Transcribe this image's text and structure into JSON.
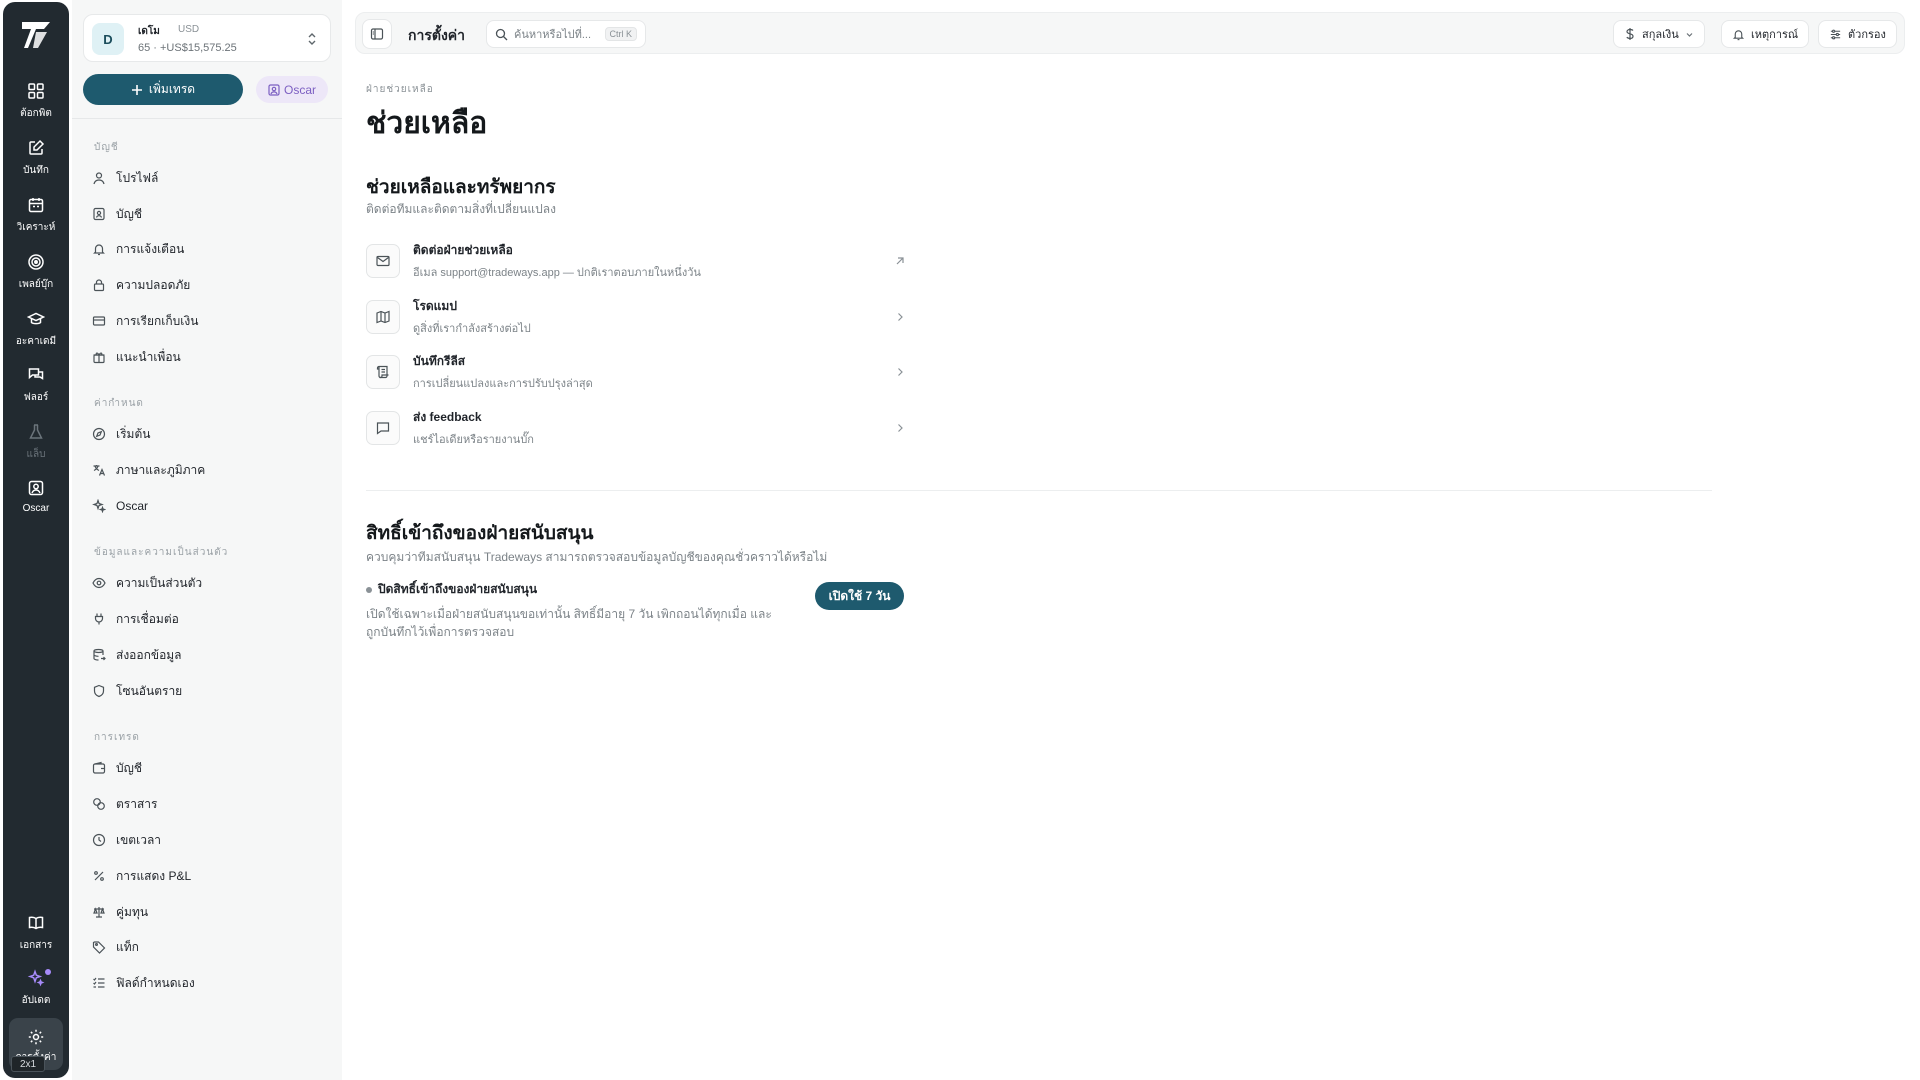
{
  "rail": {
    "items": [
      {
        "label": "ต้อกพิต",
        "icon": "dashboard-grid-icon"
      },
      {
        "label": "บันทึก",
        "icon": "journal-edit-icon"
      },
      {
        "label": "วิเคราะห์",
        "icon": "calendar-icon"
      },
      {
        "label": "เพลย์บุ๊ก",
        "icon": "target-icon"
      },
      {
        "label": "อะคาเดมี",
        "icon": "graduation-cap-icon"
      },
      {
        "label": "ฟลอร์",
        "icon": "chat-bubbles-icon"
      },
      {
        "label": "แล็บ",
        "icon": "flask-icon"
      },
      {
        "label": "Oscar",
        "icon": "oscar-portrait-icon"
      }
    ],
    "bottom": [
      {
        "label": "เอกสาร",
        "icon": "book-icon"
      },
      {
        "label": "อัปเดต",
        "icon": "sparkle-icon"
      },
      {
        "label": "การตั้งค่า",
        "icon": "gear-icon"
      }
    ],
    "badge": "2x1"
  },
  "account": {
    "avatar": "D",
    "name": "เดโม",
    "currency": "USD",
    "balance": "65 · +US$15,575.25"
  },
  "panel": {
    "add_trade": "เพิ่มเทรด",
    "oscar_chip": "Oscar",
    "sections": [
      {
        "label": "บัญชี",
        "items": [
          "โปรไฟล์",
          "บัญชี",
          "การแจ้งเตือน",
          "ความปลอดภัย",
          "การเรียกเก็บเงิน",
          "แนะนำเพื่อน"
        ]
      },
      {
        "label": "ค่ากำหนด",
        "items": [
          "เริ่มต้น",
          "ภาษาและภูมิภาค",
          "Oscar"
        ]
      },
      {
        "label": "ข้อมูลและความเป็นส่วนตัว",
        "items": [
          "ความเป็นส่วนตัว",
          "การเชื่อมต่อ",
          "ส่งออกข้อมูล",
          "โซนอันตราย"
        ]
      },
      {
        "label": "การเทรด",
        "items": [
          "บัญชี",
          "ตราสาร",
          "เขตเวลา",
          "การแสดง P&L",
          "คู่มทุน",
          "แท็ก",
          "ฟิลด์กำหนดเอง"
        ]
      }
    ]
  },
  "topbar": {
    "title": "การตั้งค่า",
    "search_placeholder": "ค้นหาหรือไปที่...",
    "search_shortcut": "Ctrl K",
    "currency": "สกุลเงิน",
    "events": "เหตุการณ์",
    "filters": "ตัวกรอง"
  },
  "main": {
    "breadcrumb": "ฝ่ายช่วยเหลือ",
    "title": "ช่วยเหลือ",
    "resources": {
      "title": "ช่วยเหลือและทรัพยากร",
      "subtitle": "ติดต่อทีมและติดตามสิ่งที่เปลี่ยนแปลง",
      "items": [
        {
          "title": "ติดต่อฝ่ายช่วยเหลือ",
          "desc": "อีเมล support@tradeways.app — ปกติเราตอบภายในหนึ่งวัน",
          "icon": "mail-icon",
          "arrow": "external-arrow-icon"
        },
        {
          "title": "โรดแมป",
          "desc": "ดูสิ่งที่เรากำลังสร้างต่อไป",
          "icon": "map-icon",
          "arrow": "chevron-right-icon"
        },
        {
          "title": "บันทึกรีลีส",
          "desc": "การเปลี่ยนแปลงและการปรับปรุงล่าสุด",
          "icon": "scroll-icon",
          "arrow": "chevron-right-icon"
        },
        {
          "title": "ส่ง feedback",
          "desc": "แชร์ไอเดียหรือรายงานบั๊ก",
          "icon": "message-square-icon",
          "arrow": "chevron-right-icon"
        }
      ]
    },
    "access": {
      "title": "สิทธิ์เข้าถึงของฝ่ายสนับสนุน",
      "subtitle": "ควบคุมว่าทีมสนับสนุน Tradeways สามารถตรวจสอบข้อมูลบัญชีของคุณชั่วคราวได้หรือไม่",
      "status_title": "ปิดสิทธิ์เข้าถึงของฝ่ายสนับสนุน",
      "status_desc": "เปิดใช้เฉพาะเมื่อฝ่ายสนับสนุนขอเท่านั้น สิทธิ์มีอายุ 7 วัน เพิกถอนได้ทุกเมื่อ และถูกบันทึกไว้เพื่อการตรวจสอบ",
      "button": "เปิดใช้ 7 วัน"
    }
  },
  "colors": {
    "rail_bg": "#222a30",
    "accent": "#1e5a6e",
    "oscar_purple": "#7c5fc2"
  }
}
